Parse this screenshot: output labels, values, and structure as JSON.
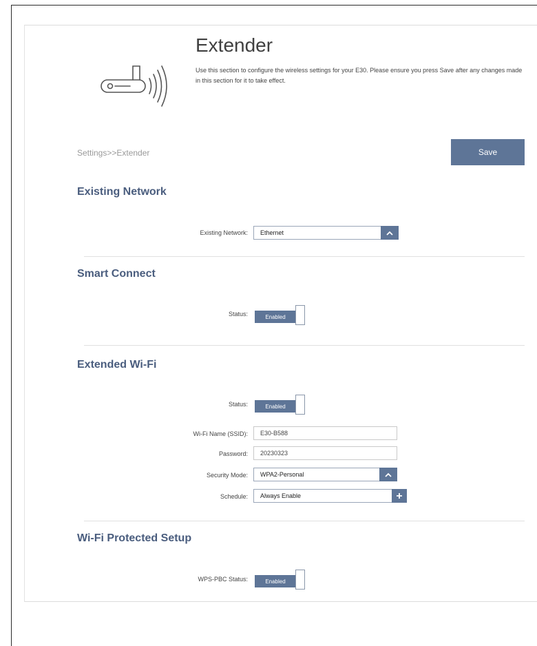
{
  "header": {
    "title": "Extender",
    "description": "Use this section to configure the wireless settings for your E30. Please ensure you press Save after any changes made in this section for it to take effect.",
    "icon": "router-wireless-icon"
  },
  "breadcrumb": "Settings>>Extender",
  "save_label": "Save",
  "sections": {
    "existing_network": {
      "title": "Existing Network",
      "field_label": "Existing Network:",
      "field_value": "Ethernet"
    },
    "smart_connect": {
      "title": "Smart Connect",
      "status_label": "Status:",
      "status_value": "Enabled"
    },
    "extended_wifi": {
      "title": "Extended Wi-Fi",
      "status_label": "Status:",
      "status_value": "Enabled",
      "ssid_label": "Wi-Fi Name (SSID):",
      "ssid_value": "E30-B588",
      "password_label": "Password:",
      "password_value": "20230323",
      "security_label": "Security Mode:",
      "security_value": "WPA2-Personal",
      "schedule_label": "Schedule:",
      "schedule_value": "Always Enable"
    },
    "wps": {
      "title": "Wi-Fi Protected Setup",
      "status_label": "WPS-PBC Status:",
      "status_value": "Enabled"
    }
  },
  "colors": {
    "accent": "#5e7597",
    "section_title": "#4a5d7e"
  }
}
